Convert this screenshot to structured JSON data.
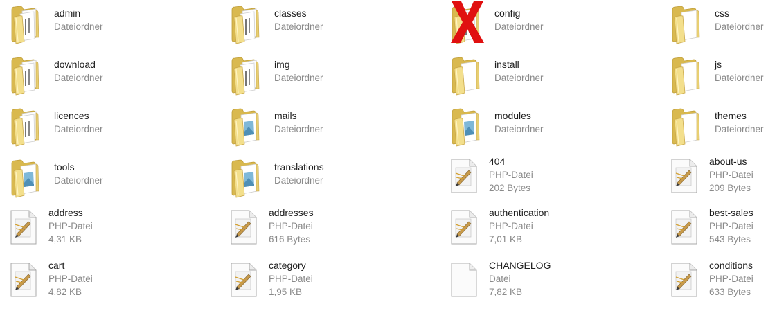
{
  "accent_colors": {
    "folder_yellow": "#e8cf72",
    "x_red": "#e01010",
    "name_text": "#1e1e1e",
    "sub_text": "#8a8a8a"
  },
  "items": [
    {
      "name": "admin",
      "type": "Dateiordner",
      "kind": "folder",
      "variant": "doc",
      "icon": "folder-icon"
    },
    {
      "name": "classes",
      "type": "Dateiordner",
      "kind": "folder",
      "variant": "doc",
      "icon": "folder-icon"
    },
    {
      "name": "config",
      "type": "Dateiordner",
      "kind": "folder",
      "variant": "doc",
      "icon": "folder-icon",
      "marked": true,
      "mark_icon": "red-x-icon"
    },
    {
      "name": "css",
      "type": "Dateiordner",
      "kind": "folder",
      "variant": "plain",
      "icon": "folder-icon"
    },
    {
      "name": "download",
      "type": "Dateiordner",
      "kind": "folder",
      "variant": "doc",
      "icon": "folder-icon"
    },
    {
      "name": "img",
      "type": "Dateiordner",
      "kind": "folder",
      "variant": "doc",
      "icon": "folder-icon"
    },
    {
      "name": "install",
      "type": "Dateiordner",
      "kind": "folder",
      "variant": "plain",
      "icon": "folder-icon"
    },
    {
      "name": "js",
      "type": "Dateiordner",
      "kind": "folder",
      "variant": "plain",
      "icon": "folder-icon"
    },
    {
      "name": "licences",
      "type": "Dateiordner",
      "kind": "folder",
      "variant": "doc",
      "icon": "folder-icon"
    },
    {
      "name": "mails",
      "type": "Dateiordner",
      "kind": "folder",
      "variant": "image",
      "icon": "folder-icon"
    },
    {
      "name": "modules",
      "type": "Dateiordner",
      "kind": "folder",
      "variant": "image",
      "icon": "folder-icon"
    },
    {
      "name": "themes",
      "type": "Dateiordner",
      "kind": "folder",
      "variant": "plain",
      "icon": "folder-icon"
    },
    {
      "name": "tools",
      "type": "Dateiordner",
      "kind": "folder",
      "variant": "image",
      "icon": "folder-icon"
    },
    {
      "name": "translations",
      "type": "Dateiordner",
      "kind": "folder",
      "variant": "image",
      "icon": "folder-icon"
    },
    {
      "name": "404",
      "type": "PHP-Datei",
      "size": "202 Bytes",
      "kind": "php",
      "icon": "php-file-icon"
    },
    {
      "name": "about-us",
      "type": "PHP-Datei",
      "size": "209 Bytes",
      "kind": "php",
      "icon": "php-file-icon"
    },
    {
      "name": "address",
      "type": "PHP-Datei",
      "size": "4,31 KB",
      "kind": "php",
      "icon": "php-file-icon"
    },
    {
      "name": "addresses",
      "type": "PHP-Datei",
      "size": "616 Bytes",
      "kind": "php",
      "icon": "php-file-icon"
    },
    {
      "name": "authentication",
      "type": "PHP-Datei",
      "size": "7,01 KB",
      "kind": "php",
      "icon": "php-file-icon"
    },
    {
      "name": "best-sales",
      "type": "PHP-Datei",
      "size": "543 Bytes",
      "kind": "php",
      "icon": "php-file-icon"
    },
    {
      "name": "cart",
      "type": "PHP-Datei",
      "size": "4,82 KB",
      "kind": "php",
      "icon": "php-file-icon"
    },
    {
      "name": "category",
      "type": "PHP-Datei",
      "size": "1,95 KB",
      "kind": "php",
      "icon": "php-file-icon"
    },
    {
      "name": "CHANGELOG",
      "type": "Datei",
      "size": "7,82 KB",
      "kind": "blank",
      "icon": "blank-file-icon"
    },
    {
      "name": "conditions",
      "type": "PHP-Datei",
      "size": "633 Bytes",
      "kind": "php",
      "icon": "php-file-icon"
    }
  ]
}
